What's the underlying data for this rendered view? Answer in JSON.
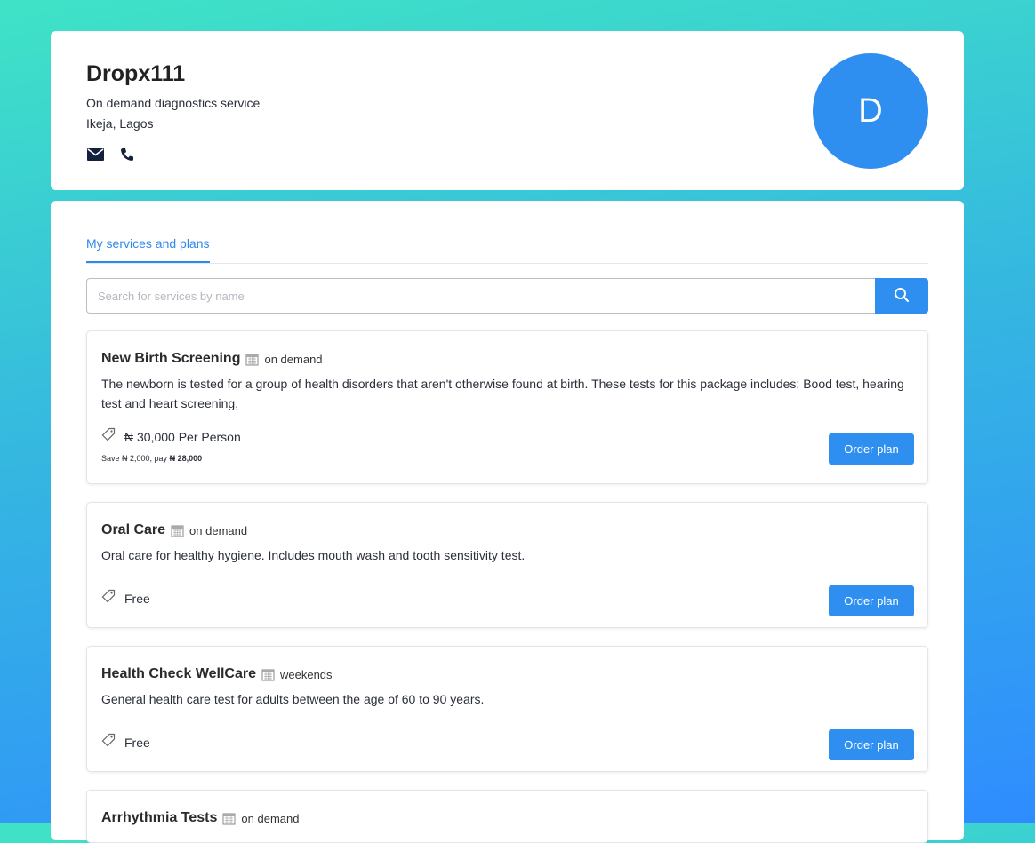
{
  "profile": {
    "name": "Dropx111",
    "tagline": "On demand diagnostics service",
    "location": "Ikeja, Lagos",
    "avatar_letter": "D",
    "avatar_color": "#2f8ff0",
    "contact_icons": [
      "mail-icon",
      "phone-icon"
    ]
  },
  "tabs": [
    {
      "label": "My services and plans",
      "active": true
    }
  ],
  "search": {
    "placeholder": "Search for services by name",
    "value": ""
  },
  "accent": "#2f8ff0",
  "services": [
    {
      "title": "New Birth Screening",
      "schedule": "on demand",
      "description": "The newborn is tested for a group of health disorders that aren't otherwise found at birth. These tests for this package includes: Bood test, hearing test and heart screening,",
      "price": "₦ 30,000 Per Person",
      "save_prefix": "Save ₦ 2,000, pay ",
      "save_amount": "₦ 28,000",
      "button": "Order plan"
    },
    {
      "title": "Oral Care",
      "schedule": "on demand",
      "description": "Oral care for healthy hygiene. Includes mouth wash and tooth sensitivity test.",
      "price": "Free",
      "button": "Order plan"
    },
    {
      "title": "Health Check WellCare",
      "schedule": "weekends",
      "description": "General health care test for adults between the age of 60 to 90 years.",
      "price": "Free",
      "button": "Order plan"
    },
    {
      "title": "Arrhythmia Tests",
      "schedule": "on demand"
    }
  ]
}
